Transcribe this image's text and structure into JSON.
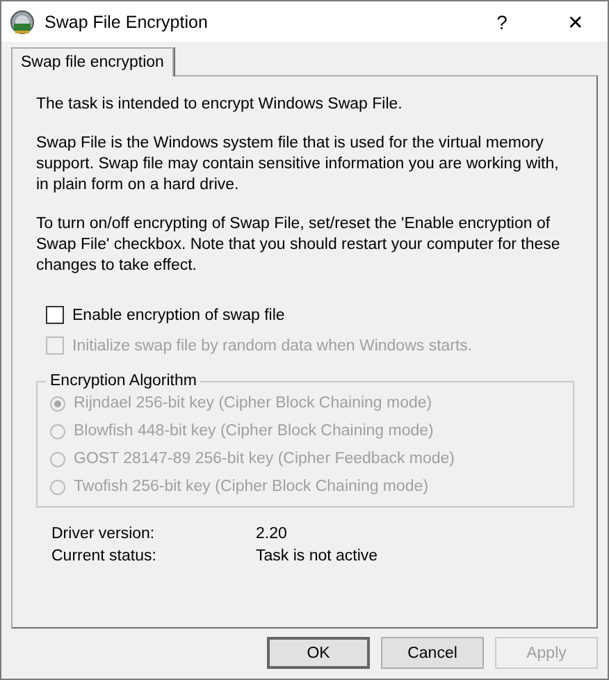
{
  "window": {
    "title": "Swap File Encryption",
    "help": "?",
    "close": "✕"
  },
  "tabs": [
    {
      "label": "Swap file encryption",
      "selected": true
    }
  ],
  "paragraphs": [
    "The task is intended to encrypt Windows Swap File.",
    "Swap File is the Windows system file that is used for the virtual memory support. Swap file may contain sensitive information you are working with, in plain form on a hard drive.",
    "To turn on/off encrypting of Swap File, set/reset the 'Enable encryption of Swap File' checkbox. Note that you should restart your computer for these changes to take effect."
  ],
  "checkboxes": [
    {
      "label": "Enable encryption of swap file",
      "checked": false,
      "disabled": false
    },
    {
      "label": "Initialize swap file by random data when Windows starts.",
      "checked": false,
      "disabled": true
    }
  ],
  "algorithm_group": {
    "title": "Encryption Algorithm",
    "options": [
      {
        "label": "Rijndael 256-bit key (Cipher Block Chaining mode)",
        "selected": true,
        "disabled": true
      },
      {
        "label": "Blowfish 448-bit key (Cipher Block Chaining mode)",
        "selected": false,
        "disabled": true
      },
      {
        "label": "GOST 28147-89 256-bit key (Cipher Feedback mode)",
        "selected": false,
        "disabled": true
      },
      {
        "label": "Twofish 256-bit key (Cipher Block Chaining mode)",
        "selected": false,
        "disabled": true
      }
    ]
  },
  "info": [
    {
      "label": "Driver version:",
      "value": "2.20"
    },
    {
      "label": "Current status:",
      "value": "Task is not active"
    }
  ],
  "buttons": [
    {
      "label": "OK",
      "default": true,
      "disabled": false
    },
    {
      "label": "Cancel",
      "default": false,
      "disabled": false
    },
    {
      "label": "Apply",
      "default": false,
      "disabled": true
    }
  ]
}
